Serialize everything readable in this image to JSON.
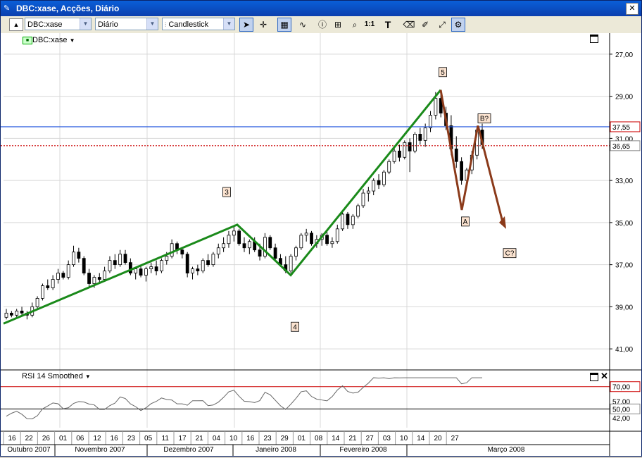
{
  "window": {
    "title": "DBC:xase, Acções, Diário"
  },
  "toolbar": {
    "symbol": "DBC:xase",
    "period": "Diário",
    "chart_style": "Candlestick",
    "tools": [
      "arrow-cursor-icon",
      "crosshair-icon",
      "grid-icon",
      "indicator-icon",
      "info-icon",
      "note-icon",
      "zoom-icon",
      "one-to-one-icon",
      "text-tool-icon",
      "eraser-icon",
      "draw-tool-icon",
      "line-tool-icon",
      "wave-tool-icon"
    ]
  },
  "legend": {
    "symbol": "DBC:xase"
  },
  "rsi": {
    "label": "RSI 14 Smoothed",
    "levels": [
      "70,00",
      "57,00",
      "50,00",
      "42,00"
    ]
  },
  "axis": {
    "price_ticks": [
      "41,00",
      "39,00",
      "37,00",
      "35,00",
      "33,00",
      "31,00",
      "29,00",
      "27,00"
    ],
    "highlight_blue": "37,55",
    "highlight_red": "36,65",
    "day_ticks": [
      "16",
      "22",
      "26",
      "01",
      "06",
      "12",
      "16",
      "23",
      "05",
      "11",
      "17",
      "21",
      "04",
      "10",
      "16",
      "23",
      "29",
      "01",
      "08",
      "14",
      "21",
      "27",
      "03",
      "10",
      "14",
      "20",
      "27"
    ],
    "months": [
      "Outubro 2007",
      "Novembro 2007",
      "Dezembro 2007",
      "Janeiro 2008",
      "Fevereiro 2008",
      "Março 2008"
    ]
  },
  "waves": {
    "labels": [
      "3",
      "4",
      "5",
      "A",
      "B?",
      "C?"
    ]
  },
  "colors": {
    "impulse": "#1a8a1a",
    "correction": "#8b3a1a",
    "blue_line": "#2255dd",
    "red_line": "#cc0000"
  },
  "chart_data": {
    "type": "candlestick",
    "title": "DBC:xase, Acções, Diário",
    "ylim": [
      26,
      42
    ],
    "yticks": [
      27,
      29,
      31,
      33,
      35,
      37,
      39,
      41
    ],
    "hlines": [
      37.55,
      36.65
    ],
    "series": [
      {
        "name": "DBC:xase",
        "candles": [
          [
            28.5,
            28.9,
            28.4,
            28.7
          ],
          [
            28.7,
            28.8,
            28.5,
            28.6
          ],
          [
            28.6,
            28.9,
            28.5,
            28.8
          ],
          [
            28.8,
            29.0,
            28.6,
            28.7
          ],
          [
            28.7,
            28.8,
            28.4,
            28.6
          ],
          [
            28.6,
            29.2,
            28.5,
            29.0
          ],
          [
            29.0,
            29.5,
            28.9,
            29.4
          ],
          [
            29.4,
            30.1,
            29.3,
            30.0
          ],
          [
            30.0,
            30.3,
            29.8,
            29.9
          ],
          [
            29.9,
            30.5,
            29.8,
            30.3
          ],
          [
            30.3,
            30.8,
            30.1,
            30.6
          ],
          [
            30.6,
            30.7,
            30.3,
            30.4
          ],
          [
            30.4,
            31.2,
            30.3,
            31.0
          ],
          [
            31.0,
            31.9,
            30.9,
            31.6
          ],
          [
            31.6,
            31.8,
            31.1,
            31.3
          ],
          [
            31.3,
            31.4,
            30.5,
            30.6
          ],
          [
            30.6,
            30.8,
            29.9,
            30.1
          ],
          [
            30.1,
            30.5,
            29.9,
            30.4
          ],
          [
            30.4,
            30.6,
            30.1,
            30.3
          ],
          [
            30.3,
            30.9,
            30.2,
            30.7
          ],
          [
            30.7,
            31.4,
            30.6,
            31.2
          ],
          [
            31.2,
            31.5,
            30.8,
            31.0
          ],
          [
            31.0,
            31.7,
            30.9,
            31.5
          ],
          [
            31.5,
            31.7,
            31.0,
            31.1
          ],
          [
            31.1,
            31.3,
            30.5,
            30.6
          ],
          [
            30.6,
            30.9,
            30.3,
            30.8
          ],
          [
            30.8,
            31.0,
            30.4,
            30.5
          ],
          [
            30.5,
            30.9,
            30.2,
            30.8
          ],
          [
            30.8,
            31.1,
            30.6,
            30.9
          ],
          [
            30.9,
            31.2,
            30.5,
            30.7
          ],
          [
            30.7,
            31.3,
            30.6,
            31.2
          ],
          [
            31.2,
            31.6,
            31.0,
            31.4
          ],
          [
            31.4,
            32.2,
            31.3,
            32.0
          ],
          [
            32.0,
            32.1,
            31.5,
            31.7
          ],
          [
            31.7,
            31.8,
            31.3,
            31.5
          ],
          [
            31.5,
            31.6,
            30.4,
            30.6
          ],
          [
            30.6,
            30.9,
            30.3,
            30.8
          ],
          [
            30.8,
            31.0,
            30.5,
            30.7
          ],
          [
            30.7,
            31.3,
            30.6,
            31.2
          ],
          [
            31.2,
            31.5,
            30.9,
            31.0
          ],
          [
            31.0,
            31.6,
            30.9,
            31.5
          ],
          [
            31.5,
            32.0,
            31.3,
            31.8
          ],
          [
            31.8,
            32.3,
            31.6,
            32.0
          ],
          [
            32.0,
            32.6,
            31.8,
            32.4
          ],
          [
            32.4,
            32.8,
            32.1,
            32.6
          ],
          [
            32.6,
            32.7,
            31.9,
            32.0
          ],
          [
            32.0,
            32.3,
            31.6,
            31.8
          ],
          [
            31.8,
            32.2,
            31.5,
            32.1
          ],
          [
            32.1,
            32.3,
            31.6,
            31.7
          ],
          [
            31.7,
            32.0,
            31.2,
            31.4
          ],
          [
            31.4,
            32.5,
            31.3,
            32.3
          ],
          [
            32.3,
            32.4,
            31.7,
            31.8
          ],
          [
            31.8,
            32.0,
            31.2,
            31.3
          ],
          [
            31.3,
            31.5,
            30.9,
            31.0
          ],
          [
            31.0,
            31.4,
            30.6,
            30.7
          ],
          [
            30.7,
            31.5,
            30.6,
            31.4
          ],
          [
            31.4,
            31.9,
            31.2,
            31.8
          ],
          [
            31.8,
            32.5,
            31.7,
            32.4
          ],
          [
            32.4,
            32.7,
            32.1,
            32.5
          ],
          [
            32.5,
            32.6,
            31.9,
            32.0
          ],
          [
            32.0,
            32.4,
            31.8,
            32.2
          ],
          [
            32.2,
            32.5,
            31.9,
            32.4
          ],
          [
            32.4,
            32.6,
            31.9,
            32.0
          ],
          [
            32.0,
            32.3,
            31.8,
            32.1
          ],
          [
            32.1,
            32.9,
            32.0,
            32.7
          ],
          [
            32.7,
            33.6,
            32.6,
            33.4
          ],
          [
            33.4,
            33.5,
            32.7,
            32.9
          ],
          [
            32.9,
            33.4,
            32.7,
            33.3
          ],
          [
            33.3,
            33.9,
            33.2,
            33.8
          ],
          [
            33.8,
            34.6,
            33.7,
            34.4
          ],
          [
            34.4,
            34.7,
            34.0,
            34.5
          ],
          [
            34.5,
            35.1,
            34.3,
            35.0
          ],
          [
            35.0,
            35.3,
            34.6,
            34.8
          ],
          [
            34.8,
            35.5,
            34.7,
            35.4
          ],
          [
            35.4,
            36.0,
            35.3,
            35.9
          ],
          [
            35.9,
            36.6,
            35.8,
            36.4
          ],
          [
            36.4,
            36.7,
            35.9,
            36.1
          ],
          [
            36.1,
            36.9,
            36.0,
            36.8
          ],
          [
            36.8,
            37.0,
            35.4,
            36.4
          ],
          [
            36.4,
            37.3,
            36.3,
            37.2
          ],
          [
            37.2,
            37.5,
            36.7,
            36.9
          ],
          [
            36.9,
            37.7,
            36.6,
            37.5
          ],
          [
            37.5,
            38.3,
            37.3,
            38.1
          ],
          [
            38.1,
            39.2,
            37.9,
            38.9
          ],
          [
            38.9,
            39.3,
            38.0,
            38.2
          ],
          [
            38.2,
            38.5,
            37.4,
            37.6
          ],
          [
            37.6,
            38.1,
            36.2,
            36.5
          ],
          [
            36.5,
            37.1,
            35.6,
            35.9
          ],
          [
            35.9,
            36.1,
            34.8,
            35.0
          ],
          [
            35.0,
            35.6,
            34.7,
            35.5
          ],
          [
            35.5,
            36.4,
            35.3,
            36.2
          ],
          [
            36.2,
            37.6,
            36.0,
            37.4
          ],
          [
            37.4,
            37.7,
            36.5,
            36.7
          ]
        ]
      }
    ]
  }
}
